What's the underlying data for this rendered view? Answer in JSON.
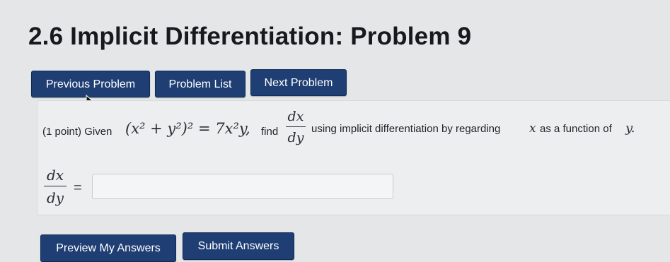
{
  "page": {
    "title": "2.6 Implicit Differentiation: Problem 9"
  },
  "nav": {
    "previous_label": "Previous Problem",
    "list_label": "Problem List",
    "next_label": "Next Problem"
  },
  "problem": {
    "points_text": "(1 point) Given",
    "equation": "(x² + y²)² = 7x²y,",
    "find_text": "find",
    "deriv_numerator": "dx",
    "deriv_denominator": "dy",
    "instruction": "using implicit differentiation by regarding",
    "var_x": "x",
    "as_function_text": "as a function of",
    "var_y": "y."
  },
  "answer": {
    "lhs_numerator": "dx",
    "lhs_denominator": "dy",
    "equals": "=",
    "value": ""
  },
  "actions": {
    "preview_label": "Preview My Answers",
    "submit_label": "Submit Answers"
  },
  "colors": {
    "button_bg": "#1f3f74",
    "page_bg": "#e4e6e7"
  }
}
